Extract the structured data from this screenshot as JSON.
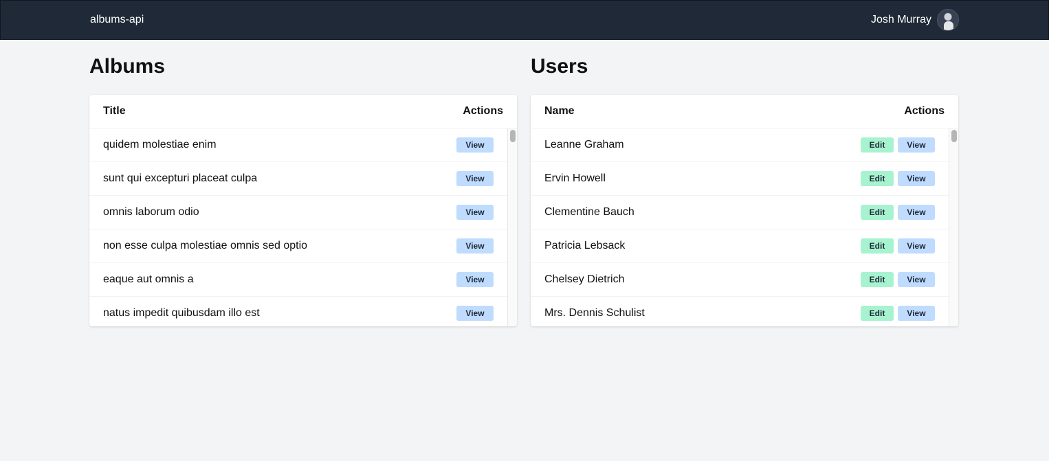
{
  "navbar": {
    "brand": "albums-api",
    "user_name": "Josh Murray"
  },
  "albums": {
    "title": "Albums",
    "columns": {
      "title": "Title",
      "actions": "Actions"
    },
    "rows": [
      {
        "title": "quidem molestiae enim",
        "view": "View"
      },
      {
        "title": "sunt qui excepturi placeat culpa",
        "view": "View"
      },
      {
        "title": "omnis laborum odio",
        "view": "View"
      },
      {
        "title": "non esse culpa molestiae omnis sed optio",
        "view": "View"
      },
      {
        "title": "eaque aut omnis a",
        "view": "View"
      },
      {
        "title": "natus impedit quibusdam illo est",
        "view": "View"
      }
    ]
  },
  "users": {
    "title": "Users",
    "columns": {
      "name": "Name",
      "actions": "Actions"
    },
    "rows": [
      {
        "name": "Leanne Graham",
        "edit": "Edit",
        "view": "View"
      },
      {
        "name": "Ervin Howell",
        "edit": "Edit",
        "view": "View"
      },
      {
        "name": "Clementine Bauch",
        "edit": "Edit",
        "view": "View"
      },
      {
        "name": "Patricia Lebsack",
        "edit": "Edit",
        "view": "View"
      },
      {
        "name": "Chelsey Dietrich",
        "edit": "Edit",
        "view": "View"
      },
      {
        "name": "Mrs. Dennis Schulist",
        "edit": "Edit",
        "view": "View"
      }
    ]
  },
  "colors": {
    "navbar": "#1f2937",
    "view_button": "#bfdbfe",
    "edit_button": "#a7f3d0",
    "background": "#f3f4f6"
  }
}
